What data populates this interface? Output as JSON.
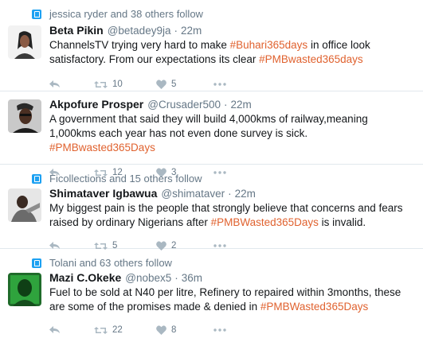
{
  "tweets": [
    {
      "context": "jessica ryder and 38 others follow",
      "name": "Beta Pikin",
      "handle": "@betadey9ja",
      "time": "22m",
      "text_parts": [
        "ChannelsTV trying very hard to make ",
        "#Buhari365days",
        " in office look satisfactory. From our expectations its clear  ",
        "#PMBwasted365days",
        ""
      ],
      "retweets": "10",
      "likes": "5"
    },
    {
      "context": "",
      "name": "Akpofure Prosper",
      "handle": "@Crusader500",
      "time": "22m",
      "text_parts": [
        "A government that said they will build 4,000kms of railway,meaning 1,000kms each year has not even done survey is sick. ",
        "#PMBwasted365Days",
        "",
        "",
        ""
      ],
      "retweets": "12",
      "likes": "3"
    },
    {
      "context": "Ficollections and 15 others follow",
      "name": "Shimataver Igbawua",
      "handle": "@shimataver",
      "time": "22m",
      "text_parts": [
        "My biggest pain is the people that strongly believe that concerns and fears raised by ordinary Nigerians after ",
        "#PMBWasted365Days",
        " is invalid.",
        "",
        ""
      ],
      "retweets": "5",
      "likes": "2"
    },
    {
      "context": "Tolani and 63 others follow",
      "name": "Mazi C.Okeke",
      "handle": "@nobex5",
      "time": "36m",
      "text_parts": [
        "Fuel to be sold at N40 per litre, Refinery to repaired within 3months, these are some of the promises made & denied in ",
        "#PMBWasted365Days",
        "",
        "",
        ""
      ],
      "retweets": "22",
      "likes": "8"
    }
  ],
  "icons": {
    "context": "follow-context-icon",
    "reply": "reply-icon",
    "retweet": "retweet-icon",
    "like": "heart-icon",
    "more": "more-dots-icon"
  },
  "colors": {
    "hashtag": "#e0622f",
    "context_icon": "#1da1f2",
    "muted": "#657786",
    "icon": "#aab8c2"
  }
}
